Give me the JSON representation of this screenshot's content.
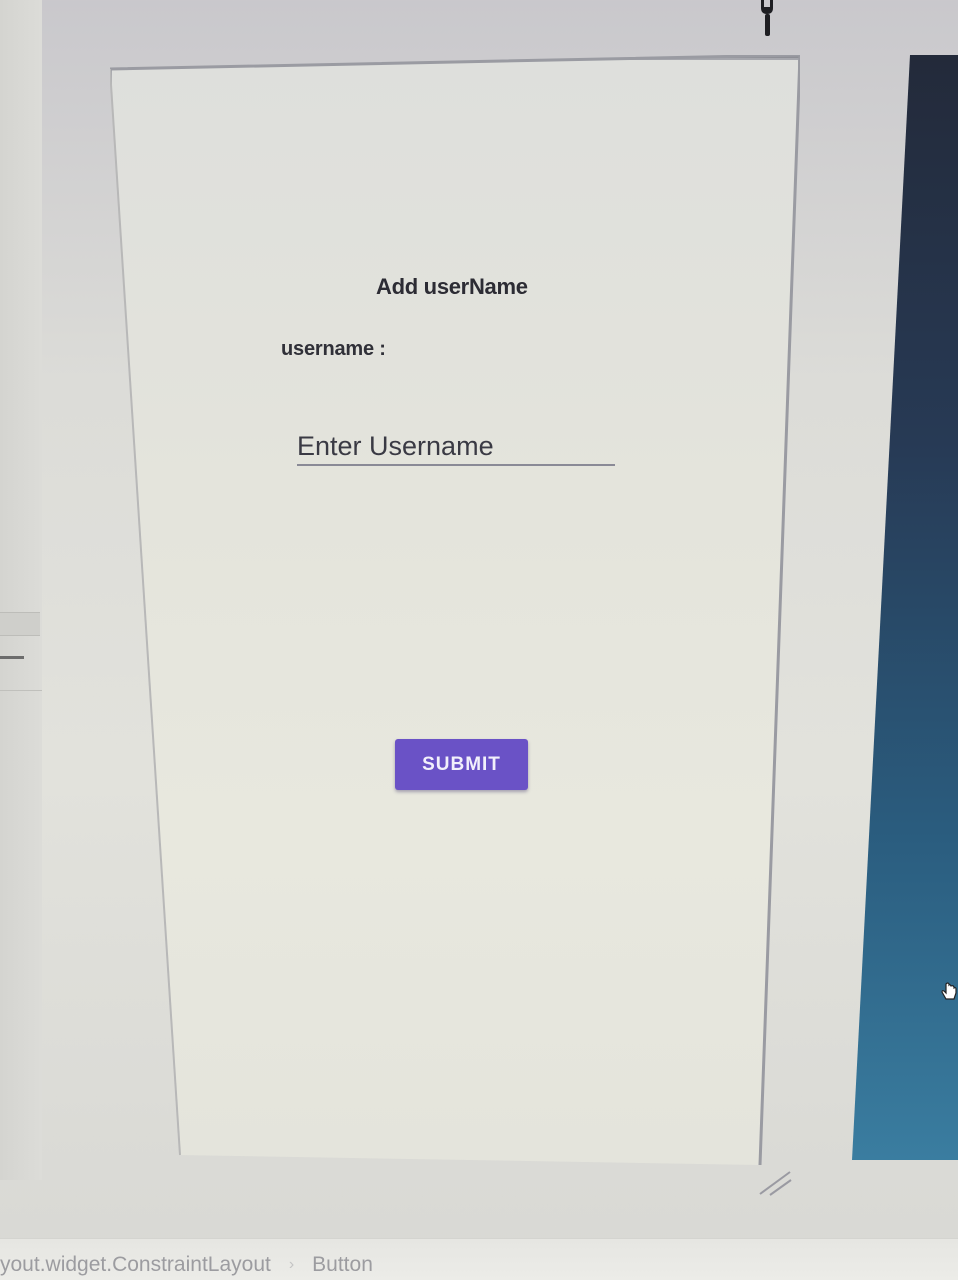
{
  "toolbar": {
    "icon": "wrench-icon"
  },
  "screen": {
    "title": "Add userName",
    "username_label": "username :",
    "username_input": {
      "value": "",
      "placeholder": "Enter Username"
    },
    "submit_label": "SUBMIT",
    "accent_color": "#6a52c6"
  },
  "breadcrumb": {
    "items": [
      "yout.widget.ConstraintLayout",
      "Button"
    ],
    "separator": "›"
  },
  "icons": {
    "resize": "resize-handle-icon",
    "cursor": "hand-cursor-icon"
  }
}
